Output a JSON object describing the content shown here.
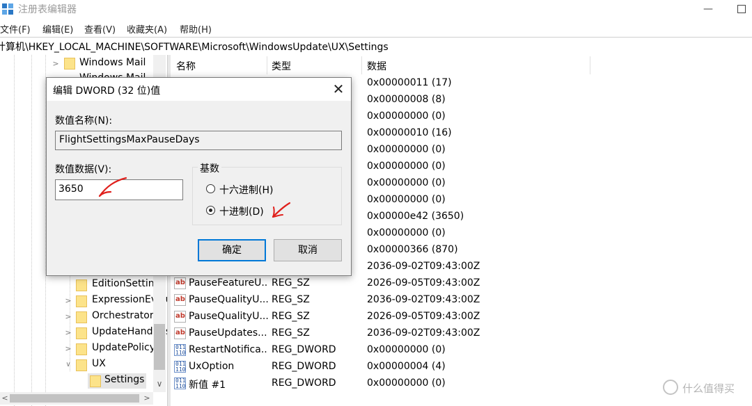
{
  "window": {
    "title": "注册表编辑器"
  },
  "menu": [
    "文件(F)",
    "编辑(E)",
    "查看(V)",
    "收藏夹(A)",
    "帮助(H)"
  ],
  "address": "计算机\\HKEY_LOCAL_MACHINE\\SOFTWARE\\Microsoft\\WindowsUpdate\\UX\\Settings",
  "tree": {
    "top_items": [
      {
        "label": "Windows Mail"
      },
      {
        "label": "Windows Mail"
      }
    ],
    "items": [
      {
        "label": "EditionSettings",
        "expandable": false
      },
      {
        "label": "ExpressionEvaluators",
        "expandable": true
      },
      {
        "label": "Orchestrator",
        "expandable": true
      },
      {
        "label": "UpdateHandlers",
        "expandable": true
      },
      {
        "label": "UpdatePolicy",
        "expandable": true
      },
      {
        "label": "UX",
        "expandable": true,
        "expanded": true
      },
      {
        "label": "Settings",
        "expandable": false,
        "selected": true
      }
    ]
  },
  "list": {
    "columns": [
      "名称",
      "类型",
      "数据"
    ],
    "rows": [
      {
        "name": "",
        "type": "",
        "data": "0x00000011 (17)",
        "icon": "binary"
      },
      {
        "name": "",
        "type": "",
        "data": "0x00000008 (8)",
        "icon": "binary"
      },
      {
        "name": "",
        "type": "",
        "data": "0x00000000 (0)",
        "icon": "binary"
      },
      {
        "name": "",
        "type": "",
        "data": "0x00000010 (16)",
        "icon": "binary"
      },
      {
        "name": "",
        "type": "",
        "data": "0x00000000 (0)",
        "icon": "binary"
      },
      {
        "name": "",
        "type": "",
        "data": "0x00000000 (0)",
        "icon": "binary"
      },
      {
        "name": "",
        "type": "",
        "data": "0x00000000 (0)",
        "icon": "binary"
      },
      {
        "name": "",
        "type": "",
        "data": "0x00000000 (0)",
        "icon": "binary"
      },
      {
        "name": "",
        "type": "",
        "data": "0x00000e42 (3650)",
        "icon": "binary"
      },
      {
        "name": "",
        "type": "",
        "data": "0x00000000 (0)",
        "icon": "binary"
      },
      {
        "name": "",
        "type": "",
        "data": "0x00000366 (870)",
        "icon": "binary"
      },
      {
        "name": "",
        "type": "",
        "data": "2036-09-02T09:43:00Z",
        "icon": "string"
      },
      {
        "name": "PauseFeatureU...",
        "type": "REG_SZ",
        "data": "2026-09-05T09:43:00Z",
        "icon": "string"
      },
      {
        "name": "PauseQualityU...",
        "type": "REG_SZ",
        "data": "2036-09-02T09:43:00Z",
        "icon": "string"
      },
      {
        "name": "PauseQualityU...",
        "type": "REG_SZ",
        "data": "2026-09-05T09:43:00Z",
        "icon": "string"
      },
      {
        "name": "PauseUpdates...",
        "type": "REG_SZ",
        "data": "2036-09-02T09:43:00Z",
        "icon": "string"
      },
      {
        "name": "RestartNotifica...",
        "type": "REG_DWORD",
        "data": "0x00000000 (0)",
        "icon": "binary"
      },
      {
        "name": "UxOption",
        "type": "REG_DWORD",
        "data": "0x00000004 (4)",
        "icon": "binary"
      },
      {
        "name": "新值 #1",
        "type": "REG_DWORD",
        "data": "0x00000000 (0)",
        "icon": "binary"
      }
    ]
  },
  "dialog": {
    "title": "编辑 DWORD (32 位)值",
    "value_name_label": "数值名称(N):",
    "value_name": "FlightSettingsMaxPauseDays",
    "value_data_label": "数值数据(V):",
    "value_data": "3650",
    "base_label": "基数",
    "base_options": [
      {
        "label": "十六进制(H)",
        "checked": false
      },
      {
        "label": "十进制(D)",
        "checked": true
      }
    ],
    "ok_label": "确定",
    "cancel_label": "取消",
    "close_glyph": "✕"
  },
  "watermark": {
    "text": "什么值得买"
  },
  "colors": {
    "annotation": "#e0201c",
    "focus": "#0078d7",
    "folder": "#fce38a"
  }
}
